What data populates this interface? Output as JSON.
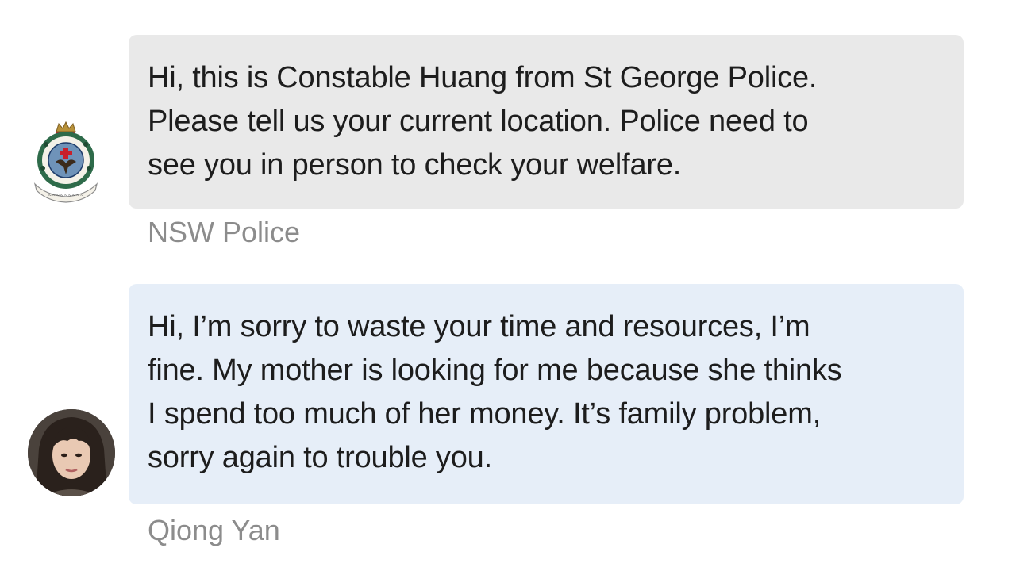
{
  "messages": [
    {
      "sender": "NSW Police",
      "avatar": "nsw-police-badge-icon",
      "text": "Hi, this is Constable Huang from St George Police.\nPlease tell us your current location. Police need to\nsee you in person to check your welfare.",
      "bubble_color": "#e9e9e9"
    },
    {
      "sender": "Qiong Yan",
      "avatar": "user-profile-photo",
      "text": "Hi, I’m sorry to waste your time and resources, I’m\nfine. My mother is looking for me because she thinks\nI spend too much of her money. It’s family problem,\nsorry again to trouble you.",
      "bubble_color": "#e6eef8"
    }
  ],
  "colors": {
    "sender_text": "#8c8c8c",
    "message_text": "#1d1d1d",
    "badge_green": "#2e6b4a",
    "badge_red": "#c8202a",
    "badge_gold": "#b8923a"
  }
}
